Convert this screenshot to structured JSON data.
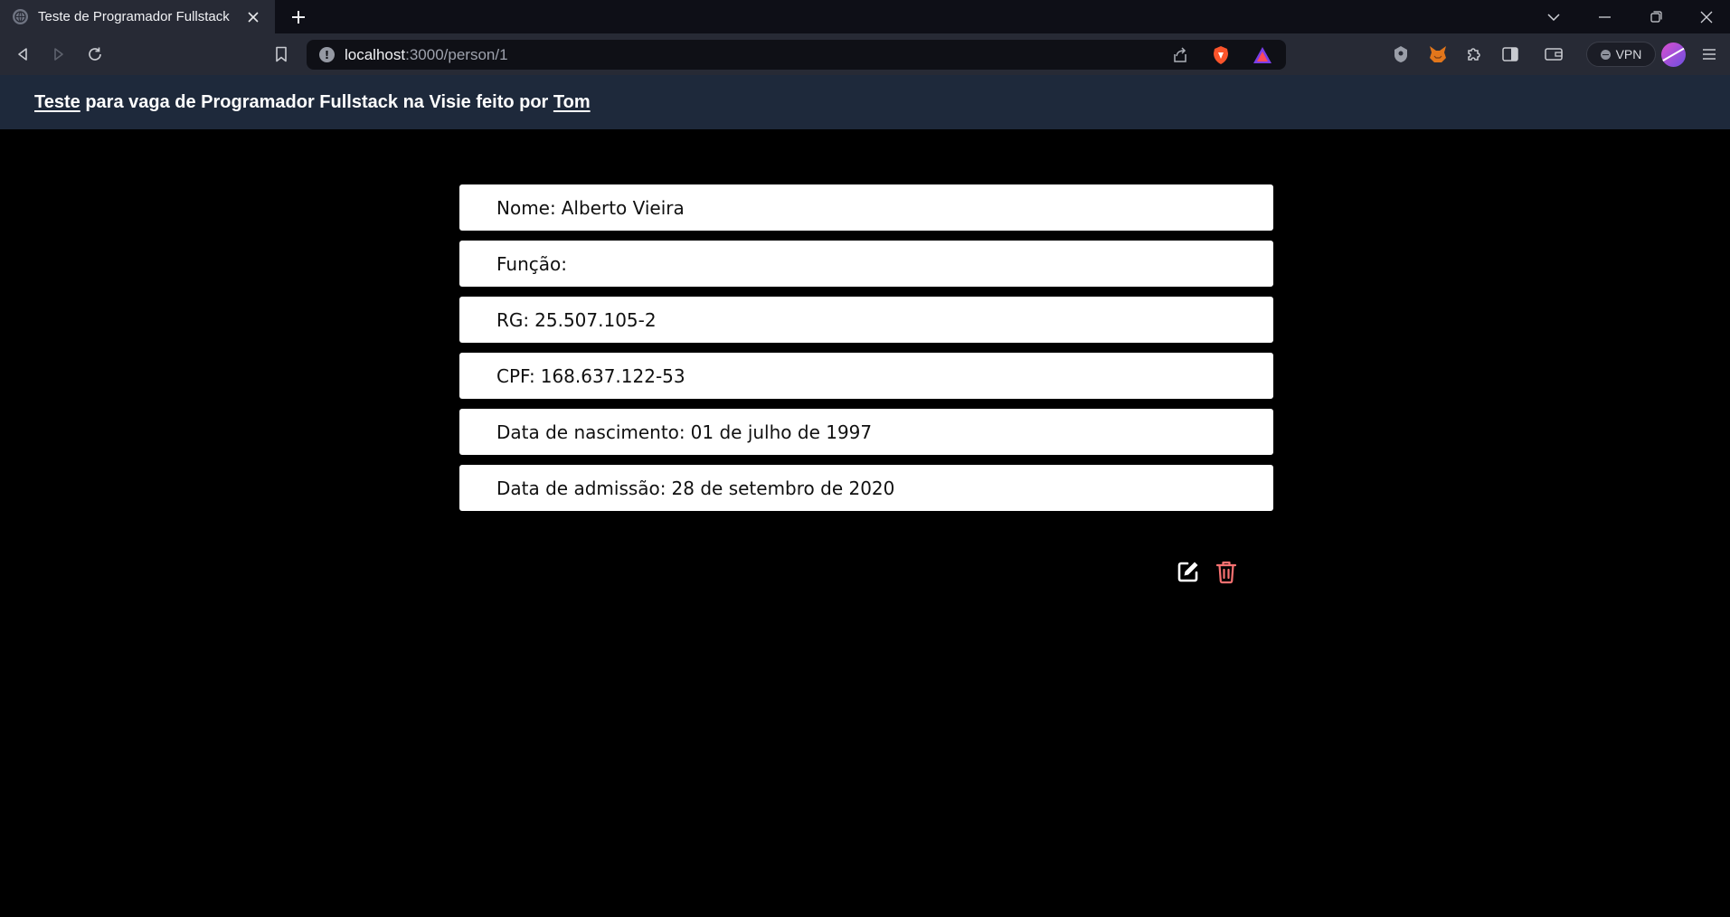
{
  "browser": {
    "tab": {
      "title": "Teste de Programador Fullstack"
    },
    "address": {
      "host": "localhost",
      "path": ":3000/person/1"
    },
    "vpn_label": "VPN"
  },
  "header": {
    "link1": "Teste",
    "middle": " para vaga de Programador Fullstack na Visie feito por ",
    "link2": "Tom"
  },
  "person": {
    "fields": [
      {
        "label": "Nome:",
        "value": "Alberto Vieira"
      },
      {
        "label": "Função:",
        "value": ""
      },
      {
        "label": "RG:",
        "value": "25.507.105-2"
      },
      {
        "label": "CPF:",
        "value": "168.637.122-53"
      },
      {
        "label": "Data de nascimento:",
        "value": "01 de julho de 1997"
      },
      {
        "label": "Data de admissão:",
        "value": "28 de setembro de 2020"
      }
    ]
  },
  "icons": {
    "edit": "edit-icon",
    "delete": "trash-icon"
  },
  "colors": {
    "header_bg": "#1e293b",
    "delete_accent": "#f87171"
  }
}
